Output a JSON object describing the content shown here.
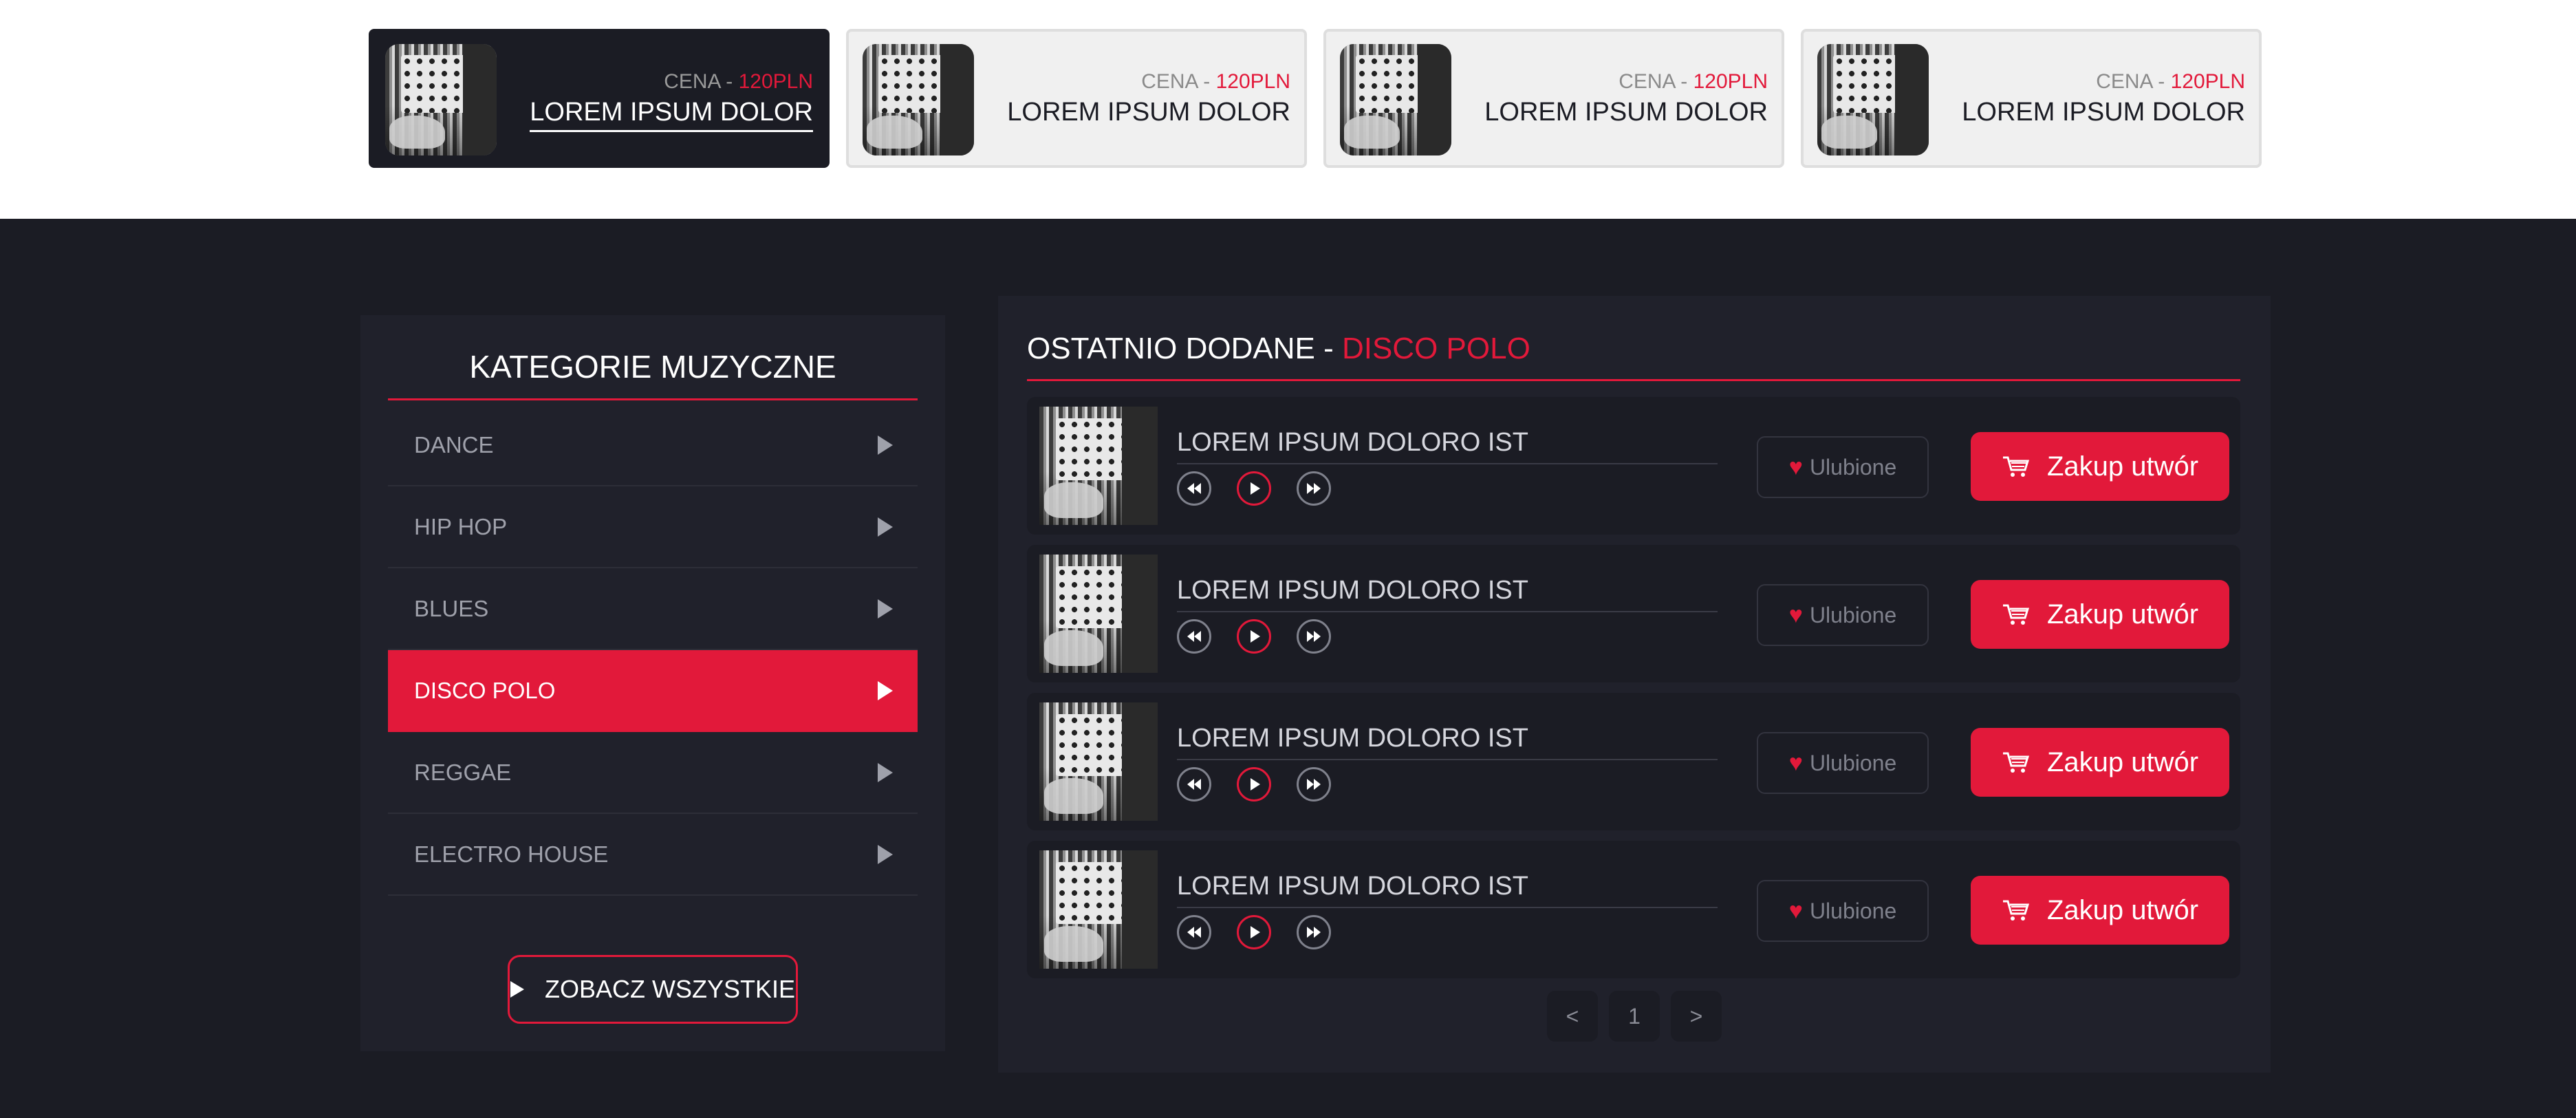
{
  "featured": [
    {
      "price_label": "CENA -",
      "price_value": "120PLN",
      "title": "LOREM IPSUM DOLOR",
      "active": true
    },
    {
      "price_label": "CENA -",
      "price_value": "120PLN",
      "title": "LOREM IPSUM DOLOR",
      "active": false
    },
    {
      "price_label": "CENA -",
      "price_value": "120PLN",
      "title": "LOREM IPSUM DOLOR",
      "active": false
    },
    {
      "price_label": "CENA -",
      "price_value": "120PLN",
      "title": "LOREM IPSUM DOLOR",
      "active": false
    }
  ],
  "sidebar": {
    "heading": "KATEGORIE MUZYCZNE",
    "categories": [
      {
        "label": "DANCE",
        "active": false
      },
      {
        "label": "HIP HOP",
        "active": false
      },
      {
        "label": "BLUES",
        "active": false
      },
      {
        "label": "DISCO POLO",
        "active": true
      },
      {
        "label": "REGGAE",
        "active": false
      },
      {
        "label": "ELECTRO HOUSE",
        "active": false
      }
    ],
    "see_all_label": "ZOBACZ WSZYSTKIE"
  },
  "main": {
    "heading_prefix": "OSTATNIO DODANE - ",
    "heading_category": "DISCO POLO",
    "tracks": [
      {
        "title": "LOREM IPSUM DOLORO IST",
        "favorite_label": "Ulubione",
        "buy_label": "Zakup utwór"
      },
      {
        "title": "LOREM IPSUM DOLORO IST",
        "favorite_label": "Ulubione",
        "buy_label": "Zakup utwór"
      },
      {
        "title": "LOREM IPSUM DOLORO IST",
        "favorite_label": "Ulubione",
        "buy_label": "Zakup utwór"
      },
      {
        "title": "LOREM IPSUM DOLORO IST",
        "favorite_label": "Ulubione",
        "buy_label": "Zakup utwór"
      }
    ],
    "pagination": {
      "prev": "<",
      "page": "1",
      "next": ">"
    }
  },
  "colors": {
    "accent": "#e2193a",
    "background": "#1b1c24",
    "panel": "#20212b"
  }
}
